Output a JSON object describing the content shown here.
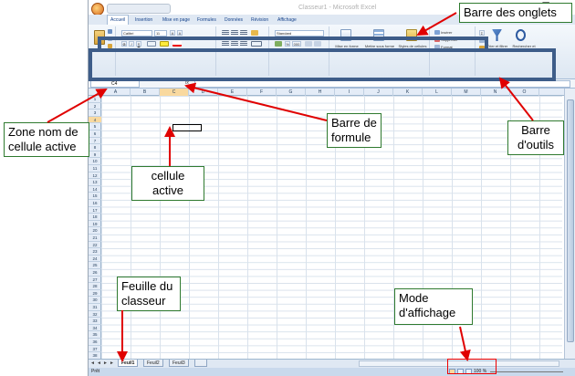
{
  "window": {
    "title": "Classeur1 - Microsoft Excel",
    "minimize": "–",
    "maximize": "❐",
    "close": "✕",
    "help": "?"
  },
  "tabs": [
    "Accueil",
    "Insertion",
    "Mise en page",
    "Formules",
    "Données",
    "Révision",
    "Affichage"
  ],
  "ribbon": {
    "paste_label": "Coller",
    "font_name": "Calibri",
    "font_size": "11",
    "bold": "G",
    "italic": "I",
    "underline": "S",
    "grow": "A",
    "shrink": "A",
    "number_format": "Standard",
    "percent": "%",
    "thousands": "000",
    "cond_format": "Mise en forme conditionnelle",
    "table_format": "Mettre sous forme de tableau",
    "cell_styles": "Styles de cellules",
    "insert": "Insérer",
    "delete": "Supprimer",
    "format": "Format",
    "sum": "Σ",
    "sort_filter": "Trier et filtrer",
    "find_select": "Rechercher et sélectionner"
  },
  "formula_bar": {
    "namebox_value": "C4",
    "fx": "fx",
    "formula_value": ""
  },
  "columns": [
    "A",
    "B",
    "C",
    "D",
    "E",
    "F",
    "G",
    "H",
    "I",
    "J",
    "K",
    "L",
    "M",
    "N",
    "O"
  ],
  "rows": [
    "1",
    "2",
    "3",
    "4",
    "5",
    "6",
    "7",
    "8",
    "9",
    "10",
    "11",
    "12",
    "13",
    "14",
    "15",
    "16",
    "17",
    "18",
    "19",
    "20",
    "21",
    "22",
    "23",
    "24",
    "25",
    "26",
    "27",
    "28",
    "29",
    "30",
    "31",
    "32",
    "33",
    "34",
    "35",
    "36",
    "37",
    "38"
  ],
  "active_cell": {
    "column": "C",
    "row": "4"
  },
  "sheets": [
    "Feuil1",
    "Feuil2",
    "Feuil3"
  ],
  "status": {
    "mode": "Prêt",
    "zoom": "100 %"
  },
  "callouts": {
    "tabs_bar": "Barre des onglets",
    "formula_bar": "Barre de formule",
    "name_box": "Zone nom de cellule active",
    "active_cell": "cellule active",
    "toolbar": "Barre d'outils",
    "sheet": "Feuille du classeur",
    "view_mode": "Mode d'affichage"
  },
  "colors": {
    "frame": "#3e5d89",
    "arrow": "#e00000",
    "callout_border": "#2f7a2f"
  }
}
